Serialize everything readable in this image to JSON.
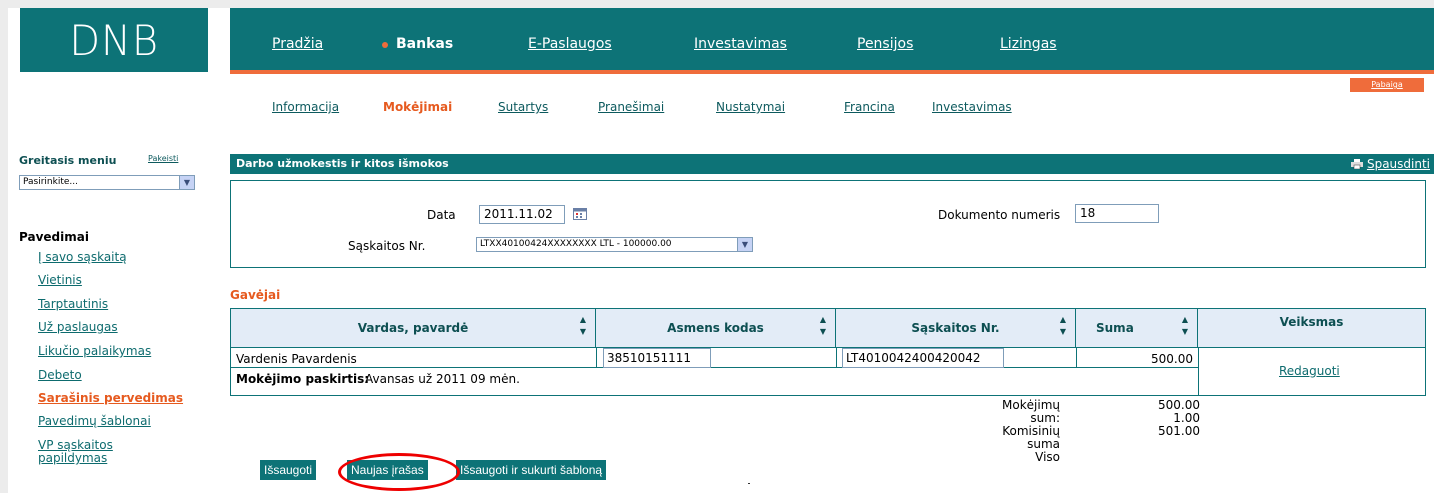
{
  "logo": "DNB",
  "topnav": {
    "items": [
      {
        "label": "Pradžia",
        "active": false
      },
      {
        "label": "Bankas",
        "active": true
      },
      {
        "label": "E-Paslaugos",
        "active": false
      },
      {
        "label": "Investavimas",
        "active": false
      },
      {
        "label": "Pensijos",
        "active": false
      },
      {
        "label": "Lizingas",
        "active": false
      }
    ],
    "logout_label": "Pabaiga"
  },
  "subnav": {
    "items": [
      {
        "label": "Informacija",
        "active": false
      },
      {
        "label": "Mokėjimai",
        "active": true
      },
      {
        "label": "Sutartys",
        "active": false
      },
      {
        "label": "Pranešimai",
        "active": false
      },
      {
        "label": "Nustatymai",
        "active": false
      },
      {
        "label": "Francina",
        "active": false
      },
      {
        "label": "Investavimas",
        "active": false
      }
    ]
  },
  "sidebar": {
    "quick_menu_label": "Greitasis meniu",
    "quick_menu_change": "Pakeisti",
    "quick_menu_select": "Pasirinkite...",
    "section_title": "Pavedimai",
    "items": [
      {
        "label": "Į savo sąskaitą",
        "active": false
      },
      {
        "label": "Vietinis",
        "active": false
      },
      {
        "label": "Tarptautinis",
        "active": false
      },
      {
        "label": "Už paslaugas",
        "active": false
      },
      {
        "label": "Likučio palaikymas",
        "active": false
      },
      {
        "label": "Debeto",
        "active": false
      },
      {
        "label": "Sarašinis pervedimas",
        "active": true
      },
      {
        "label": "Pavedimų šablonai",
        "active": false
      },
      {
        "label": "VP sąskaitos",
        "active": false
      },
      {
        "label": "papildymas",
        "active": false
      }
    ]
  },
  "main": {
    "section_title": "Darbo užmokestis ir kitos išmokos",
    "print_label": "Spausdinti",
    "form": {
      "date_label": "Data",
      "date_value": "2011.11.02",
      "doc_label": "Dokumento numeris",
      "doc_value": "18",
      "account_label": "Sąskaitos Nr.",
      "account_value": "LTXX40100424XXXXXXXX LTL - 100000.00"
    },
    "recipients_title": "Gavėjai",
    "table": {
      "headers": [
        "Vardas, pavardė",
        "Asmens kodas",
        "Sąskaitos Nr.",
        "Suma",
        "Veiksmas"
      ],
      "row": {
        "name": "Vardenis Pavardenis",
        "personal_code": "38510151111",
        "account": "LT4010042400420042",
        "amount": "500.00",
        "action": "Redaguoti"
      },
      "purpose_label": "Mokėjimo paskirtis:",
      "purpose_value": "Avansas už 2011 09 mėn."
    },
    "totals": {
      "payments_label": "Mokėjimų sum:",
      "payments_value": "500.00",
      "commission_label": "Komisinių suma",
      "commission_value": "1.00",
      "total_label": "Viso",
      "total_value": "501.00"
    },
    "buttons": {
      "save": "Išsaugoti",
      "new_record": "Naujas įrašas",
      "save_template": "Išsaugoti ir sukurti šabloną"
    }
  },
  "colors": {
    "brand_teal": "#0d7377",
    "accent_orange": "#ef6c3b",
    "highlight_red": "#e00000"
  }
}
